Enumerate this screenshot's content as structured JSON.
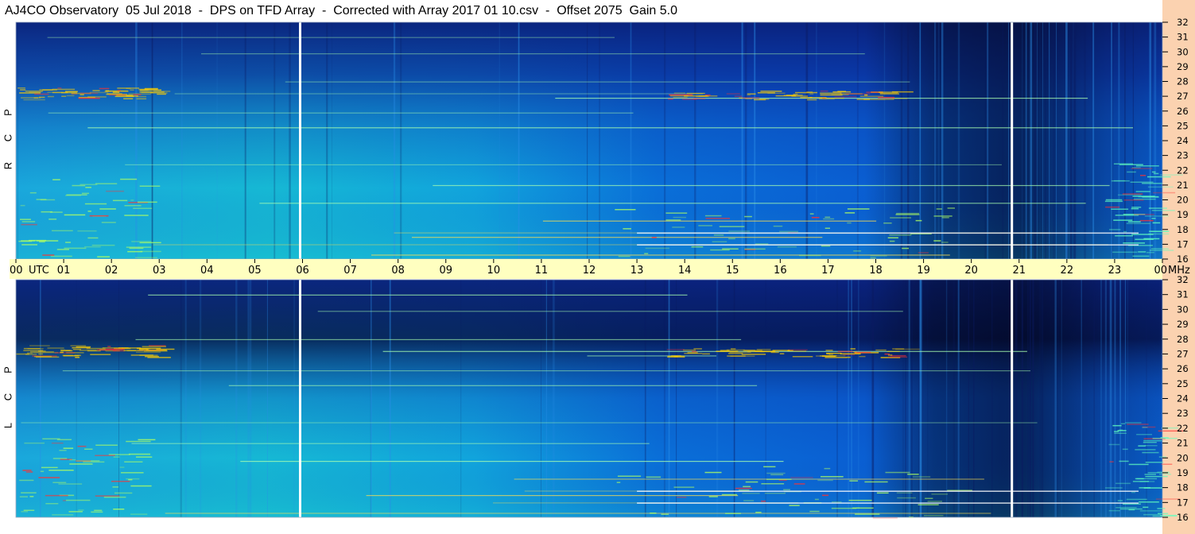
{
  "header": {
    "title": "AJ4CO Observatory  05 Jul 2018  -  DPS on TFD Array  -  Corrected with Array 2017 01 10.csv  -  Offset 2075  Gain 5.0"
  },
  "colors": {
    "time_axis_bg": "#ffffc0",
    "freq_axis_bg": "#fbd2b0",
    "low_intensity": "#0a1f7a",
    "mid_intensity": "#0a7ddc",
    "high_intensity": "#ffffff"
  },
  "chart_data": [
    {
      "type": "heatmap",
      "panel": "top",
      "polarization_label": [
        "R",
        "C",
        "P"
      ],
      "x_unit": "UTC",
      "y_unit": "MHz",
      "xlim": [
        0,
        24
      ],
      "ylim": [
        16,
        32
      ],
      "y_ticks": [
        16,
        17,
        18,
        19,
        20,
        21,
        22,
        23,
        24,
        25,
        26,
        27,
        28,
        29,
        30,
        31,
        32
      ],
      "marker_lines_utc": [
        5.95,
        20.85
      ]
    },
    {
      "type": "heatmap",
      "panel": "bottom",
      "polarization_label": [
        "L",
        "C",
        "P"
      ],
      "x_unit": "UTC",
      "y_unit": "MHz",
      "xlim": [
        0,
        24
      ],
      "ylim": [
        16,
        32
      ],
      "y_ticks": [
        16,
        17,
        18,
        19,
        20,
        21,
        22,
        23,
        24,
        25,
        26,
        27,
        28,
        29,
        30,
        31,
        32
      ],
      "marker_lines_utc": [
        5.95,
        20.85
      ]
    }
  ],
  "time_axis": {
    "ticks": [
      "00",
      "01",
      "02",
      "03",
      "04",
      "05",
      "06",
      "07",
      "08",
      "09",
      "10",
      "11",
      "12",
      "13",
      "14",
      "15",
      "16",
      "17",
      "18",
      "19",
      "20",
      "21",
      "22",
      "23",
      "00"
    ],
    "utc_label": "UTC",
    "mhz_label": "MHz"
  }
}
